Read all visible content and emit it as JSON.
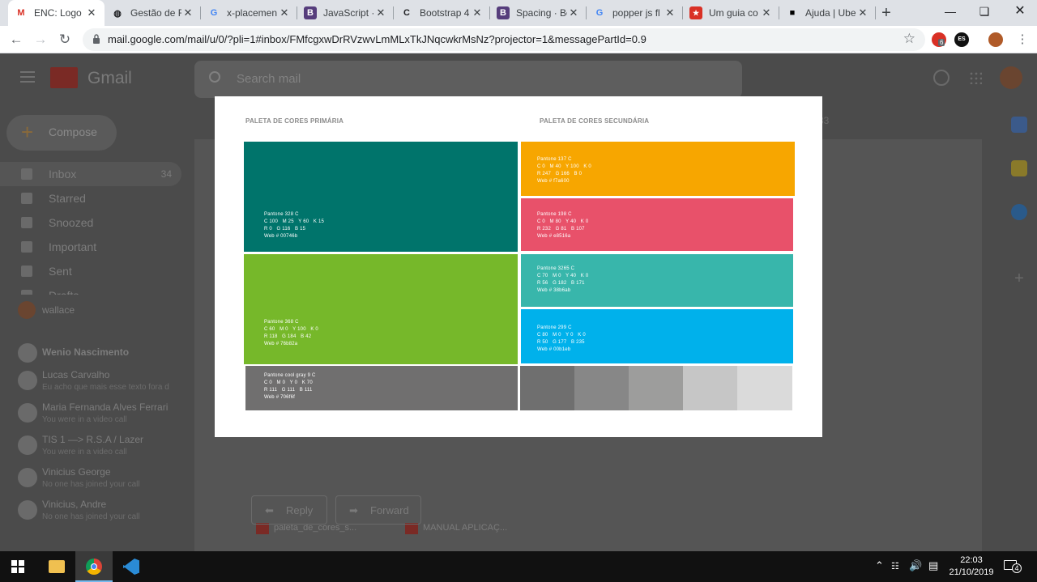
{
  "browser": {
    "tabs": [
      {
        "title": "ENC: Logo",
        "icon": "gmail-icon",
        "color": "#d93025",
        "glyph": "M",
        "active": true
      },
      {
        "title": "Gestão de F",
        "icon": "github-icon",
        "color": "#202124",
        "glyph": "◍",
        "active": false
      },
      {
        "title": "x-placemen",
        "icon": "google-icon",
        "color": "#4285f4",
        "glyph": "G",
        "active": false
      },
      {
        "title": "JavaScript ·",
        "icon": "bootstrap-icon",
        "color": "#563d7c",
        "glyph": "B",
        "active": false
      },
      {
        "title": "Bootstrap 4",
        "icon": "codeply-icon",
        "color": "#202124",
        "glyph": "C",
        "active": false
      },
      {
        "title": "Spacing · Bo",
        "icon": "bootstrap-icon",
        "color": "#563d7c",
        "glyph": "B",
        "active": false
      },
      {
        "title": "popper js fl",
        "icon": "google-icon",
        "color": "#4285f4",
        "glyph": "G",
        "active": false
      },
      {
        "title": "Um guia co",
        "icon": "bookmark-red-icon",
        "color": "#d93025",
        "glyph": "★",
        "active": false
      },
      {
        "title": "Ajuda | Ube",
        "icon": "uber-icon",
        "color": "#000000",
        "glyph": "■",
        "active": false
      }
    ],
    "url": "mail.google.com/mail/u/0/?pli=1#inbox/FMfcgxwDrRVzwvLmMLxTkJNqcwkrMsNz?projector=1&messagePartId=0.9",
    "ext_badge": "6",
    "ext_lang": "ES"
  },
  "gmail": {
    "app_name": "Gmail",
    "search_placeholder": "Search mail",
    "compose_label": "Compose",
    "nav": [
      {
        "label": "Inbox",
        "count": "34"
      },
      {
        "label": "Starred",
        "count": ""
      },
      {
        "label": "Snoozed",
        "count": ""
      },
      {
        "label": "Important",
        "count": ""
      },
      {
        "label": "Sent",
        "count": ""
      },
      {
        "label": "Drafts",
        "count": ""
      }
    ],
    "account": "wallace",
    "people": [
      {
        "name": "Wenio Nascimento",
        "sub": ""
      },
      {
        "name": "Lucas Carvalho",
        "sub": "Eu acho que mais esse texto fora d"
      },
      {
        "name": "Maria Fernanda Alves Ferrari",
        "sub": "You were in a video call"
      },
      {
        "name": "TIS 1 —> R.S.A / Lazer",
        "sub": "You were in a video call"
      },
      {
        "name": "Vinicius George",
        "sub": "No one has joined your call"
      },
      {
        "name": "Vinicius, Andre",
        "sub": "No one has joined your call"
      }
    ],
    "pager": "33",
    "attachments": [
      "paleta_de_cores_s...",
      "MANUAL APLICAÇ..."
    ],
    "reply_label": "Reply",
    "forward_label": "Forward"
  },
  "palette": {
    "primary_heading": "PALETA DE CORES PRIMÁRIA",
    "secondary_heading": "PALETA DE CORES SECUNDÁRIA",
    "swatches": [
      {
        "id": "pantone-328c",
        "color": "#00746b",
        "lines": [
          "Pantone 328 C",
          "C 100   M 25   Y 60   K 15",
          "R 0   G 116   B 15",
          "Web # 00746b"
        ]
      },
      {
        "id": "pantone-368c",
        "color": "#76b82a",
        "lines": [
          "Pantone 368 C",
          "C 60   M 0   Y 100   K 0",
          "R 118   G 184   B 42",
          "Web # 76b82a"
        ]
      },
      {
        "id": "pantone-cool-gray-9c",
        "color": "#706f6f",
        "lines": [
          "Pantone cool gray 9 C",
          "C 0   M 0   Y 0   K 70",
          "R 111   G 111   B 111",
          "Web # 706f6f"
        ]
      },
      {
        "id": "pantone-137c",
        "color": "#f7a600",
        "lines": [
          "Pantone 137 C",
          "C 0   M 40   Y 100   K 0",
          "R 247   G 166   B 0",
          "Web # f7a600"
        ]
      },
      {
        "id": "pantone-198c",
        "color": "#e8516a",
        "lines": [
          "Pantone 198 C",
          "C 0   M 80   Y 40   K 0",
          "R 232   G 81   B 107",
          "Web # e8516a"
        ]
      },
      {
        "id": "pantone-3265c",
        "color": "#38b6ab",
        "lines": [
          "Pantone 3265 C",
          "C 70   M 0   Y 40   K 0",
          "R 56   G 182   B 171",
          "Web # 38b6ab"
        ]
      },
      {
        "id": "pantone-299c",
        "color": "#00b1eb",
        "lines": [
          "Pantone 299 C",
          "C 80   M 0   Y 0   K 0",
          "R 50   G 177   B 235",
          "Web # 00b1eb"
        ]
      }
    ],
    "gray_steps": [
      "#6f6f6f",
      "#878787",
      "#9d9d9c",
      "#c6c6c6",
      "#dadada"
    ]
  },
  "taskbar": {
    "time": "22:03",
    "date": "21/10/2019",
    "notif_count": "4"
  }
}
